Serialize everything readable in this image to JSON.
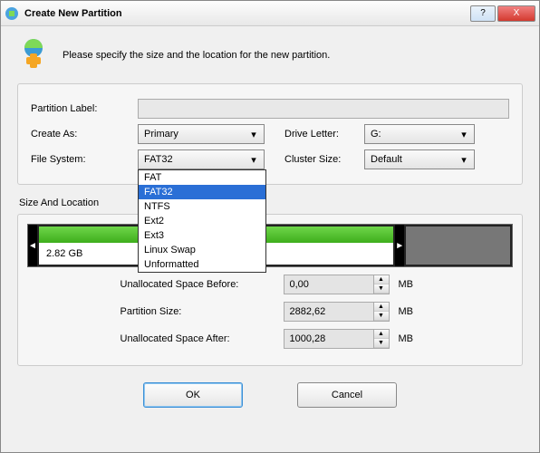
{
  "title": "Create New Partition",
  "intro": "Please specify the size and the location for the new partition.",
  "labels": {
    "partitionLabel": "Partition Label:",
    "createAs": "Create As:",
    "driveLetter": "Drive Letter:",
    "fileSystem": "File System:",
    "clusterSize": "Cluster Size:",
    "sizeLocation": "Size And Location",
    "spaceBefore": "Unallocated Space Before:",
    "partitionSize": "Partition Size:",
    "spaceAfter": "Unallocated Space After:",
    "unit": "MB"
  },
  "values": {
    "partitionLabel": "",
    "createAs": "Primary",
    "driveLetter": "G:",
    "fileSystem": "FAT32",
    "clusterSize": "Default",
    "segSize": "2.82 GB",
    "spaceBefore": "0,00",
    "partitionSize": "2882,62",
    "spaceAfter": "1000,28"
  },
  "fsOptions": [
    "FAT",
    "FAT32",
    "NTFS",
    "Ext2",
    "Ext3",
    "Linux Swap",
    "Unformatted"
  ],
  "buttons": {
    "ok": "OK",
    "cancel": "Cancel",
    "help": "?",
    "close": "X"
  }
}
